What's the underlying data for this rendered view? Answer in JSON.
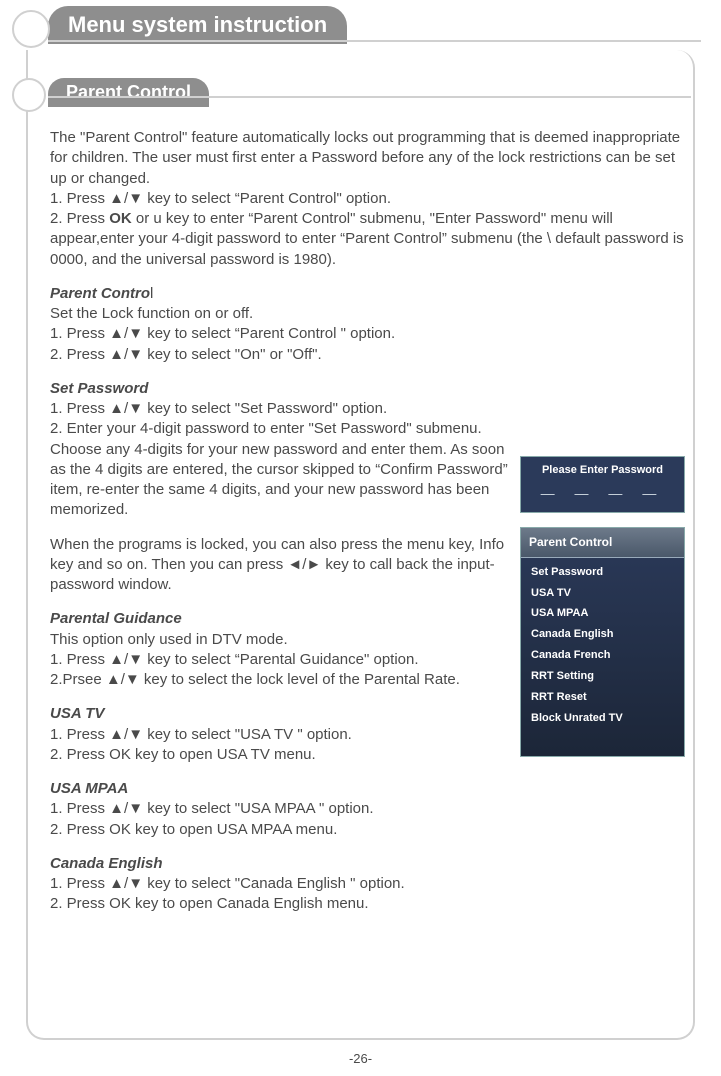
{
  "header": {
    "title": "Menu system instruction"
  },
  "section": {
    "title": "Parent  Control"
  },
  "intro": {
    "p1": "The \"Parent  Control\" feature automatically locks out programming that is deemed inappropriate for children. The user must first enter a Password before any of the lock restrictions can be set up or changed.",
    "s1": "1. Press ▲/▼ key to select “Parent  Control\" option.",
    "s2a": "2. Press ",
    "s2b": "OK",
    "s2c": " or u key to enter “Parent  Control\" submenu, \"Enter Password\" menu will appear,enter your 4-digit password to enter “Parent  Control” submenu (the \\ default password  is  0000, and the  universal password is 1980)."
  },
  "pc": {
    "title": "Parent  Contro",
    "title_tail": "l",
    "line": "Set the Lock function on or off.",
    "s1": "1. Press ▲/▼ key to select “Parent  Control \" option.",
    "s2": "2. Press ▲/▼ key to select \"On\" or \"Off\"."
  },
  "setpw": {
    "title_a": "Set ",
    "title_b": "Password",
    "s1": "1. Press ▲/▼ key to select \"Set Password\" option.",
    "s2": "2. Enter your 4-digit password to enter  \"Set Password\" submenu. Choose any 4-digits for your new password and enter them. As soon as the 4 digits are entered, the cursor skipped to “Confirm Password” item, re-enter the same 4 digits, and your new password has been memorized.",
    "note": "When the programs is locked, you can also press the menu key, Info key and so on. Then you can press ◄/► key  to call back the input-password window."
  },
  "pg": {
    "title": "Parental Guidance",
    "line": "This option only used in DTV mode.",
    "s1": "1. Press ▲/▼ key to select “Parental Guidance\" option.",
    "s2": "2.Prsee ▲/▼ key  to select the lock level of the Parental Rate."
  },
  "usatv": {
    "title": "USA TV",
    "s1": "1. Press ▲/▼ key to select \"USA TV \" option.",
    "s2": "2. Press OK key to open USA TV menu."
  },
  "usampaa": {
    "title": "USA MPAA",
    "s1": "1. Press ▲/▼ key to select \"USA MPAA \" option.",
    "s2": "2. Press OK key to open USA MPAA menu."
  },
  "caneng": {
    "title": "Canada English",
    "s1": "1. Press ▲/▼ key to select \"Canada English \" option.",
    "s2": "2. Press OK key to open Canada English menu."
  },
  "osd": {
    "pw_title": "Please Enter Password",
    "pw_slots": "— — — —",
    "menu_title": "Parent  Control",
    "items": [
      "Set Password",
      "USA TV",
      "USA MPAA",
      "Canada English",
      "Canada French",
      "RRT Setting",
      "RRT Reset",
      "Block Unrated TV"
    ]
  },
  "footer": {
    "page": "-26-"
  }
}
